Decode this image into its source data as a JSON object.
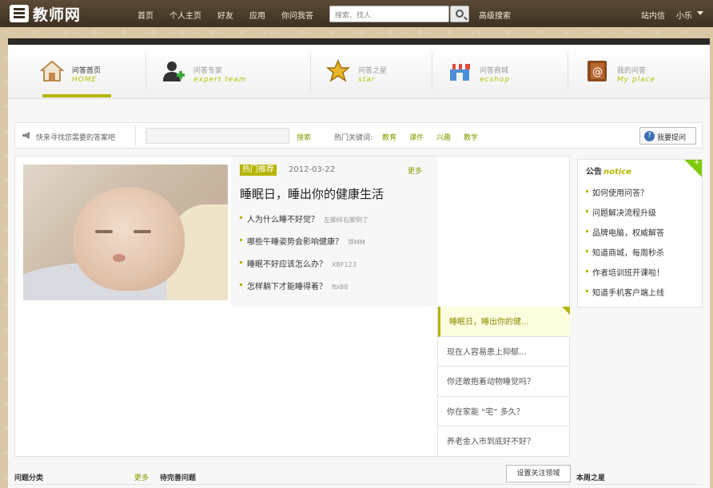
{
  "site": {
    "logo_text": "教师网"
  },
  "topbar": {
    "nav": [
      "首页",
      "个人主页",
      "好友",
      "应用",
      "你问我答"
    ],
    "search_placeholder": "搜索、找人",
    "advanced_search": "高级搜索",
    "messages": "站内信",
    "user": "小乐"
  },
  "tabs": [
    {
      "title": "问答首页",
      "sub": "HOME",
      "icon": "home-icon",
      "active": true
    },
    {
      "title": "问答专家",
      "sub": "expert team",
      "icon": "expert-icon",
      "active": false
    },
    {
      "title": "问答之星",
      "sub": "star",
      "icon": "star-icon",
      "active": false
    },
    {
      "title": "问答商城",
      "sub": "ecshop",
      "icon": "shop-icon",
      "active": false
    },
    {
      "title": "我的问答",
      "sub": "My place",
      "icon": "my-place-icon",
      "active": false
    }
  ],
  "search_bar": {
    "label": "快来寻找您需要的答案吧",
    "input_value": "",
    "button": "搜索",
    "hot_label": "热门关键词:",
    "keywords": [
      "教育",
      "课件",
      "兴趣",
      "教学"
    ],
    "ask_button": "我要提问"
  },
  "featured": {
    "badge": "热门推荐",
    "date": "2012-03-22",
    "more": "更多",
    "title": "睡眠日，睡出你的健康生活",
    "items": [
      {
        "text": "人为什么睡不好觉？",
        "author": "左脚绊右脚倒了"
      },
      {
        "text": "哪些午睡姿势会影响健康？",
        "author": "萍MM"
      },
      {
        "text": "睡眠不好应该怎么办？",
        "author": "XBF123"
      },
      {
        "text": "怎样躺下才能睡得着？",
        "author": "fbi88"
      }
    ],
    "side_list": [
      "睡眠日，睡出你的健...",
      "现在人容易患上抑郁...",
      "你还敢抱着动物睡觉吗？",
      "你在家能 “宅” 多久？",
      "养老金入市到底好不好？"
    ]
  },
  "notice": {
    "title": "公告",
    "title_en": "notice",
    "items": [
      "如何使用问答？",
      "问题解决流程升级",
      "品牌电脑，权威解答",
      "知道商城，每周秒杀",
      "作者培训班开课啦！",
      "知道手机客户端上线"
    ]
  },
  "bottom": {
    "categories": "问题分类",
    "more": "更多",
    "pending": "待完善问题",
    "follow_button": "设置关注领域",
    "weekly_star": "本周之星"
  },
  "colors": {
    "accent": "#b5b500",
    "topbar": "#3e3123",
    "link": "#8a9a00"
  }
}
